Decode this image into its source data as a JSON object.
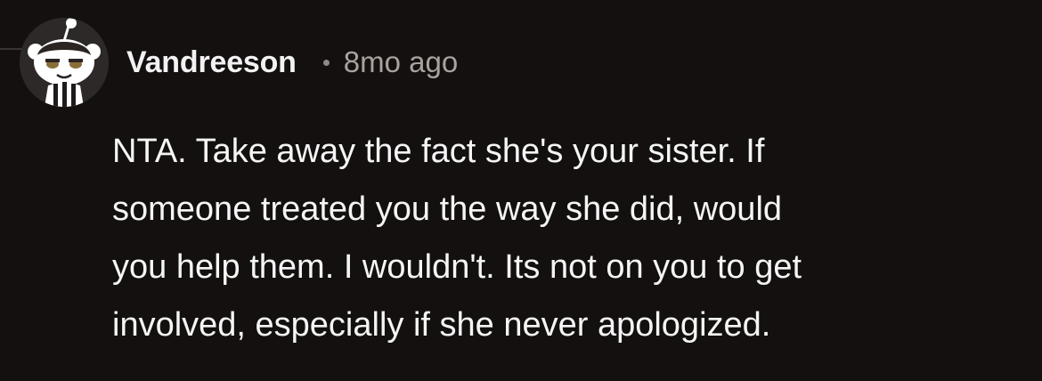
{
  "comment": {
    "author": "Vandreeson",
    "separator": "•",
    "timestamp": "8mo ago",
    "avatar_icon": "reddit-snoo-avatar-icon",
    "body_lines": [
      "NTA. Take away the fact she's your sister. If",
      "someone treated you the way she did, would",
      "you help them. I wouldn't. Its not on you to get",
      "involved, especially if she never apologized."
    ]
  },
  "colors": {
    "background": "#13100f",
    "username": "#f2f2f2",
    "timestamp": "#a9a29e",
    "body_text": "#f5f5f5"
  }
}
